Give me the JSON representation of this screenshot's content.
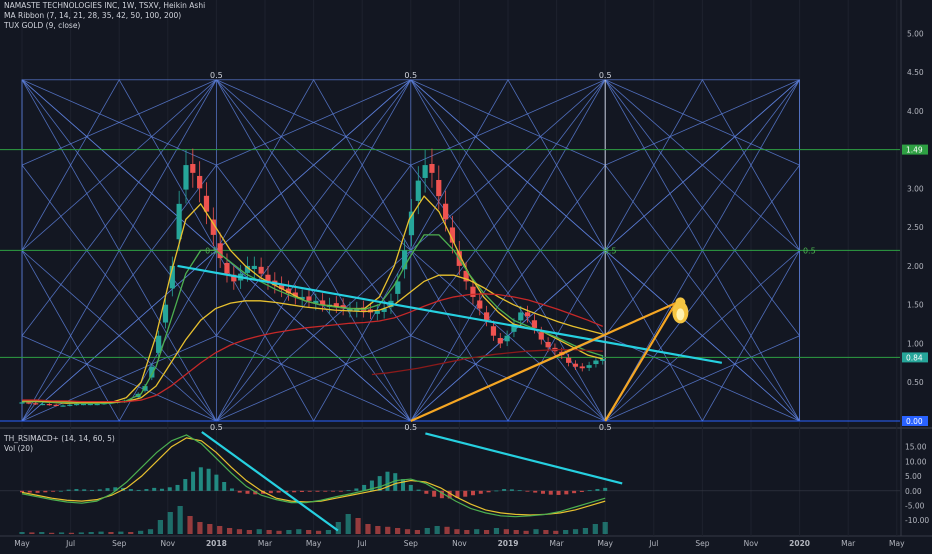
{
  "header": {
    "title": "NAMASTE TECHNOLOGIES INC, 1W, TSXV, Heikin Ashi",
    "study1": "MA Ribbon (7, 14, 21, 28, 35, 42, 50, 100, 200)",
    "study2": "TUX GOLD (9, close)"
  },
  "lower_pane": {
    "study1": "TH_RSIMACD+ (14, 14, 60, 5)",
    "study2": "Vol (20)"
  },
  "colors": {
    "background": "#131722",
    "up": "#26a69a",
    "down": "#ef5350",
    "fib": "#5b7cd6",
    "green_line": "#2ea043",
    "cyan": "#26d0e0",
    "orange": "#f5a623",
    "ma_yellow": "#e8c12f",
    "ma_red": "#b22222"
  },
  "chart_data": [
    {
      "type": "candlestick",
      "style": "Heikin Ashi",
      "y_scale": "linear",
      "ylim": [
        0,
        5.3
      ],
      "y_ticks": [
        {
          "label": "5.00",
          "value": 5.0
        },
        {
          "label": "4.50",
          "value": 4.5
        },
        {
          "label": "4.00",
          "value": 4.0
        },
        {
          "label": "3.50",
          "value": 3.5
        },
        {
          "label": "3.00",
          "value": 3.0
        },
        {
          "label": "2.50",
          "value": 2.5
        },
        {
          "label": "2.00",
          "value": 2.0
        },
        {
          "label": "1.50",
          "value": 1.5
        },
        {
          "label": "1.00",
          "value": 1.0
        },
        {
          "label": "0.50",
          "value": 0.5
        }
      ],
      "x_ticks": [
        "May",
        "Jul",
        "Sep",
        "Nov",
        "2018",
        "Mar",
        "May",
        "Jul",
        "Sep",
        "Nov",
        "2019",
        "Mar",
        "May",
        "Jul",
        "Sep",
        "Nov",
        "2020",
        "Mar",
        "May"
      ],
      "price_badges": [
        {
          "label": "1.49",
          "value": 3.5,
          "color": "#2ea043"
        },
        {
          "label": "0.84",
          "value": 0.82,
          "color": "#26a69a"
        },
        {
          "label": "0.00",
          "value": 0.0,
          "color": "#2962ff"
        }
      ],
      "fib_labels": [
        {
          "label": "0.5",
          "x_index": 4.0,
          "value": 4.46
        },
        {
          "label": "0.5",
          "x_index": 8.0,
          "value": 4.46
        },
        {
          "label": "0.5",
          "x_index": 12.0,
          "value": 4.46
        },
        {
          "label": "0.5",
          "x_index": 4.0,
          "value": -0.08
        },
        {
          "label": "0.5",
          "x_index": 8.0,
          "value": -0.08
        },
        {
          "label": "0.5",
          "x_index": 12.0,
          "value": -0.08
        },
        {
          "label": "0.5",
          "x_index": 3.9,
          "value": 2.2
        },
        {
          "label": "0.5",
          "x_index": 12.1,
          "value": 2.2
        },
        {
          "label": "0.5",
          "x_index": 16.2,
          "value": 2.2
        }
      ],
      "fib_grid": {
        "x_start": 0,
        "x_end": 16,
        "x_cols": [
          0,
          4,
          8,
          12,
          16
        ],
        "y_low": 0,
        "y_high": 4.4,
        "y_mid": 2.2
      },
      "horizontal_lines": [
        {
          "value": 3.5,
          "color": "#2ea043"
        },
        {
          "value": 2.2,
          "color": "#2ea043"
        },
        {
          "value": 0.82,
          "color": "#2ea043"
        },
        {
          "value": 0.0,
          "color": "#2962ff"
        }
      ],
      "trend_lines": [
        {
          "color": "#26d0e0",
          "points": [
            [
              3.2,
              2.0
            ],
            [
              14.4,
              0.75
            ]
          ]
        },
        {
          "color": "#f5a623",
          "points": [
            [
              8.0,
              0.0
            ],
            [
              13.45,
              1.52
            ]
          ]
        },
        {
          "color": "#f5a623",
          "points": [
            [
              12.0,
              0.0
            ],
            [
              13.45,
              1.52
            ]
          ]
        }
      ],
      "annotations": [
        {
          "label": "tux",
          "x_index": 13.3,
          "value": 1.4
        }
      ],
      "series": [
        {
          "kind": "candles",
          "x_start": 0.0,
          "x_end": 11.95,
          "values": [
            0.24,
            0.23,
            0.22,
            0.22,
            0.21,
            0.2,
            0.2,
            0.21,
            0.22,
            0.22,
            0.22,
            0.22,
            0.23,
            0.24,
            0.25,
            0.26,
            0.28,
            0.35,
            0.45,
            0.7,
            1.1,
            1.5,
            2.0,
            2.8,
            3.3,
            3.2,
            3.0,
            2.7,
            2.4,
            2.1,
            1.9,
            1.8,
            1.9,
            2.0,
            2.0,
            1.9,
            1.8,
            1.75,
            1.7,
            1.65,
            1.6,
            1.6,
            1.55,
            1.55,
            1.5,
            1.5,
            1.48,
            1.45,
            1.45,
            1.45,
            1.42,
            1.4,
            1.42,
            1.45,
            1.55,
            1.8,
            2.2,
            2.7,
            3.1,
            3.3,
            3.2,
            2.9,
            2.6,
            2.3,
            2.0,
            1.8,
            1.6,
            1.45,
            1.3,
            1.1,
            1.0,
            1.1,
            1.25,
            1.4,
            1.35,
            1.2,
            1.05,
            0.95,
            0.9,
            0.85,
            0.75,
            0.7,
            0.68,
            0.72,
            0.78,
            0.8
          ]
        },
        {
          "kind": "ma",
          "name": "",
          "color": "#e8c12f",
          "x_start": 0.0,
          "x_end": 11.95,
          "values": [
            0.25,
            0.25,
            0.24,
            0.23,
            0.23,
            0.23,
            0.24,
            0.3,
            0.5,
            1.1,
            1.9,
            2.6,
            2.8,
            2.5,
            2.2,
            2.0,
            1.85,
            1.75,
            1.65,
            1.55,
            1.5,
            1.48,
            1.45,
            1.45,
            1.6,
            2.0,
            2.6,
            2.9,
            2.7,
            2.3,
            1.9,
            1.6,
            1.4,
            1.25,
            1.2,
            1.15,
            1.05,
            0.95,
            0.85,
            0.8
          ]
        },
        {
          "kind": "ma",
          "name": "",
          "color": "#4caf50",
          "x_start": 0.0,
          "x_end": 11.95,
          "values": [
            0.25,
            0.25,
            0.24,
            0.24,
            0.23,
            0.23,
            0.23,
            0.26,
            0.35,
            0.7,
            1.3,
            1.9,
            2.2,
            2.2,
            2.05,
            1.9,
            1.8,
            1.7,
            1.62,
            1.55,
            1.5,
            1.47,
            1.45,
            1.44,
            1.5,
            1.75,
            2.1,
            2.4,
            2.4,
            2.2,
            1.9,
            1.65,
            1.45,
            1.3,
            1.22,
            1.15,
            1.07,
            0.98,
            0.9,
            0.84
          ]
        },
        {
          "kind": "ma",
          "name": "",
          "color": "#e8c12f",
          "x_start": 0.0,
          "x_end": 11.95,
          "values": [
            0.26,
            0.26,
            0.25,
            0.25,
            0.24,
            0.24,
            0.24,
            0.25,
            0.3,
            0.45,
            0.75,
            1.05,
            1.3,
            1.45,
            1.52,
            1.55,
            1.55,
            1.53,
            1.5,
            1.47,
            1.45,
            1.43,
            1.42,
            1.41,
            1.43,
            1.5,
            1.65,
            1.8,
            1.88,
            1.88,
            1.82,
            1.72,
            1.6,
            1.5,
            1.42,
            1.35,
            1.28,
            1.22,
            1.17,
            1.12
          ]
        },
        {
          "kind": "ma",
          "name": "",
          "color": "#c62828",
          "x_start": 0.0,
          "x_end": 11.95,
          "values": [
            0.27,
            0.27,
            0.26,
            0.26,
            0.25,
            0.25,
            0.25,
            0.25,
            0.27,
            0.33,
            0.45,
            0.6,
            0.75,
            0.88,
            0.98,
            1.05,
            1.1,
            1.14,
            1.17,
            1.2,
            1.22,
            1.24,
            1.26,
            1.27,
            1.29,
            1.33,
            1.4,
            1.48,
            1.55,
            1.6,
            1.63,
            1.64,
            1.63,
            1.6,
            1.56,
            1.5,
            1.44,
            1.37,
            1.3,
            1.22
          ]
        },
        {
          "kind": "ma",
          "name": "",
          "color": "#8b1a1a",
          "x_start": 7.2,
          "x_end": 11.95,
          "values": [
            0.6,
            0.62,
            0.65,
            0.68,
            0.72,
            0.76,
            0.8,
            0.83,
            0.86,
            0.88,
            0.9,
            0.91,
            0.92,
            0.92,
            0.91,
            0.9
          ]
        }
      ]
    },
    {
      "type": "line",
      "ylim": [
        -14,
        20
      ],
      "y_ticks": [
        {
          "label": "15.00",
          "value": 15
        },
        {
          "label": "10.00",
          "value": 10
        },
        {
          "label": "5.00",
          "value": 5
        },
        {
          "label": "0.00",
          "value": 0
        },
        {
          "label": "-5.00",
          "value": -5
        },
        {
          "label": "-10.00",
          "value": -10
        }
      ],
      "trend_lines": [
        {
          "color": "#26d0e0",
          "points": [
            [
              3.7,
              20
            ],
            [
              6.5,
              -13.5
            ]
          ]
        },
        {
          "color": "#26d0e0",
          "points": [
            [
              8.3,
              19.5
            ],
            [
              12.35,
              2.5
            ]
          ]
        }
      ],
      "series": [
        {
          "kind": "histogram",
          "x_start": 0.0,
          "x_end": 12.0,
          "values": [
            -0.5,
            -0.6,
            -0.7,
            -0.5,
            -0.3,
            0,
            0.4,
            0.6,
            0.5,
            0.3,
            0.5,
            0.9,
            1.2,
            1.0,
            0.6,
            0.3,
            0.6,
            1.0,
            0.7,
            1.2,
            2.0,
            4.0,
            6.5,
            8.0,
            7.5,
            5.5,
            3.0,
            0.8,
            -0.6,
            -1.0,
            -1.2,
            -1.0,
            -0.8,
            -0.6,
            -0.5,
            -0.5,
            -0.4,
            -0.3,
            -0.3,
            -0.2,
            -0.2,
            -0.1,
            0.2,
            0.8,
            2.0,
            3.5,
            5.0,
            6.5,
            6.0,
            4.0,
            2.0,
            0.4,
            -1.0,
            -2.0,
            -2.5,
            -2.6,
            -2.4,
            -2.0,
            -1.5,
            -1.0,
            -0.5,
            0.1,
            0.6,
            0.5,
            0.2,
            -0.2,
            -0.6,
            -1.0,
            -1.3,
            -1.4,
            -1.2,
            -0.8,
            -0.4,
            0.2,
            0.6,
            1.0
          ]
        },
        {
          "kind": "line",
          "name": "",
          "color": "#e8c12f",
          "x_start": 0.0,
          "x_end": 12.0,
          "values": [
            -0.5,
            -1.5,
            -2.5,
            -3.2,
            -3.5,
            -3.0,
            -1.5,
            1.0,
            5.0,
            10.0,
            15.0,
            18.0,
            17.0,
            13.0,
            8.0,
            3.5,
            0,
            -2.5,
            -3.5,
            -3.8,
            -3.5,
            -2.5,
            -1.5,
            -0.5,
            0.5,
            2.5,
            3.5,
            3.0,
            1.0,
            -2.0,
            -4.5,
            -6.5,
            -7.5,
            -8.0,
            -8.2,
            -8.0,
            -7.5,
            -6.5,
            -5.0,
            -3.5
          ]
        },
        {
          "kind": "line",
          "name": "",
          "color": "#4caf50",
          "x_start": 0.0,
          "x_end": 12.0,
          "values": [
            -1.0,
            -2.0,
            -3.0,
            -3.8,
            -4.2,
            -3.5,
            -1.0,
            3.0,
            8.0,
            13.0,
            17.0,
            19.0,
            16.0,
            11.0,
            6.0,
            1.5,
            -1.5,
            -3.0,
            -4.0,
            -4.0,
            -3.2,
            -2.0,
            -1.0,
            0.2,
            1.5,
            3.5,
            4.0,
            2.5,
            -0.5,
            -3.5,
            -6.0,
            -7.5,
            -8.5,
            -8.8,
            -8.5,
            -8.0,
            -7.0,
            -5.5,
            -4.0,
            -2.5
          ]
        },
        {
          "kind": "volume",
          "x_start": 0.0,
          "x_end": 12.0,
          "values": [
            0.05,
            0.04,
            0.05,
            0.03,
            0.04,
            0.03,
            0.04,
            0.05,
            0.06,
            0.05,
            0.06,
            0.05,
            0.08,
            0.12,
            0.35,
            0.55,
            0.7,
            0.45,
            0.3,
            0.25,
            0.2,
            0.15,
            0.12,
            0.1,
            0.12,
            0.1,
            0.08,
            0.1,
            0.12,
            0.1,
            0.08,
            0.1,
            0.3,
            0.5,
            0.4,
            0.25,
            0.2,
            0.18,
            0.15,
            0.12,
            0.1,
            0.15,
            0.2,
            0.18,
            0.12,
            0.1,
            0.12,
            0.1,
            0.15,
            0.12,
            0.1,
            0.08,
            0.12,
            0.1,
            0.08,
            0.1,
            0.12,
            0.15,
            0.25,
            0.3
          ]
        }
      ]
    }
  ]
}
